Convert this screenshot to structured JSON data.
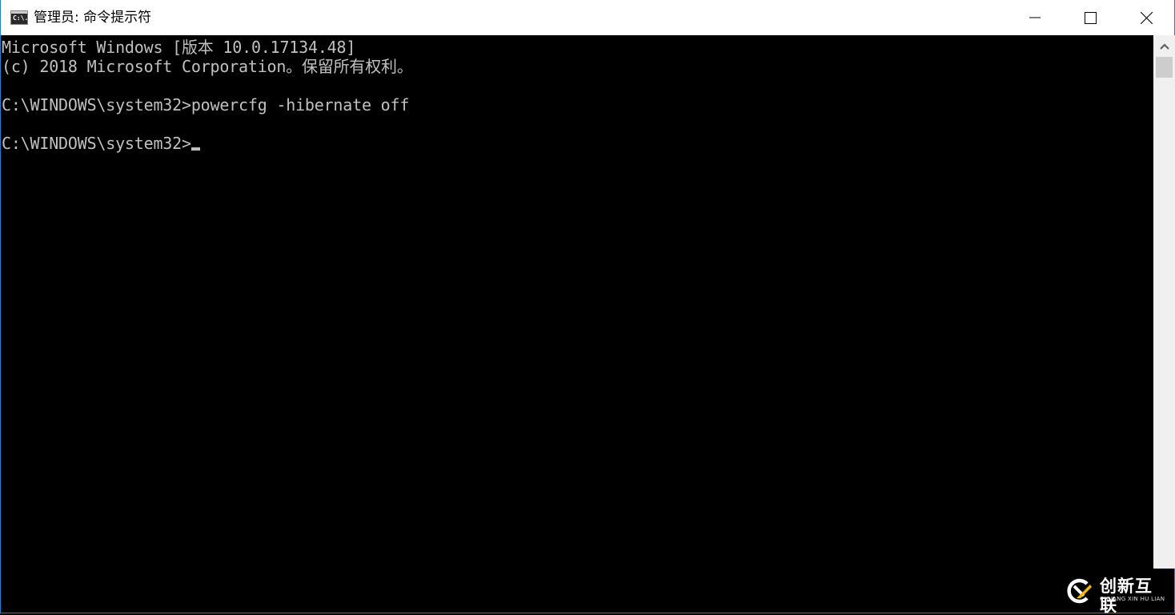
{
  "window": {
    "title": "管理员: 命令提示符",
    "app_icon_text": "C:\\.",
    "controls": {
      "minimize": "minimize",
      "maximize": "maximize",
      "close": "close"
    }
  },
  "console": {
    "lines": [
      "Microsoft Windows [版本 10.0.17134.48]",
      "(c) 2018 Microsoft Corporation。保留所有权利。",
      "",
      "C:\\WINDOWS\\system32>powercfg -hibernate off",
      "",
      "C:\\WINDOWS\\system32>"
    ],
    "text_color": "#c0c0c0",
    "background": "#000000"
  },
  "watermark": {
    "brand_cn": "创新互联",
    "brand_en": "CHUANG XIN HU LIAN"
  },
  "colors": {
    "window_border": "#1883d7",
    "titlebar": "#ffffff",
    "scrollbar_track": "#f0f0f0",
    "scrollbar_thumb": "#cdcdcd",
    "watermark_accent": "#f5b800"
  }
}
